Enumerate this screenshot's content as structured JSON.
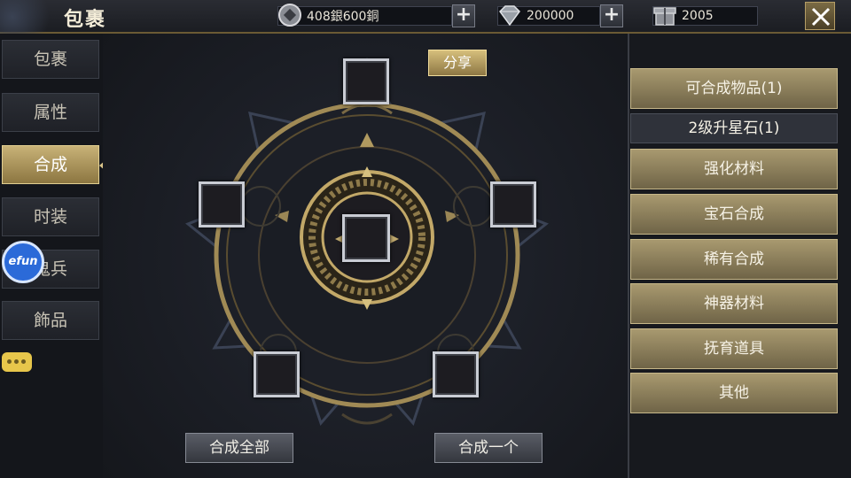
{
  "header": {
    "title": "包裹",
    "resources": [
      {
        "icon": "coin-icon",
        "value": "408銀600銅"
      },
      {
        "icon": "diamond-icon",
        "value": "200000"
      },
      {
        "icon": "gift-icon",
        "value": "2005"
      }
    ]
  },
  "tabs": [
    {
      "label": "包裹"
    },
    {
      "label": "属性"
    },
    {
      "label": "合成",
      "active": true
    },
    {
      "label": "时装"
    },
    {
      "label": "鬼兵"
    },
    {
      "label": "飾品"
    }
  ],
  "efun": {
    "label": "efun"
  },
  "center": {
    "share_label": "分享",
    "combine_all_label": "合成全部",
    "combine_one_label": "合成一个"
  },
  "categories": [
    {
      "label": "可合成物品(1)"
    },
    {
      "label": "2级升星石(1)",
      "sub": true
    },
    {
      "label": "强化材料"
    },
    {
      "label": "宝石合成"
    },
    {
      "label": "稀有合成"
    },
    {
      "label": "神器材料"
    },
    {
      "label": "抚育道具"
    },
    {
      "label": "其他"
    }
  ],
  "colors": {
    "accent": "#c8b277",
    "ring": "#a08a55"
  }
}
